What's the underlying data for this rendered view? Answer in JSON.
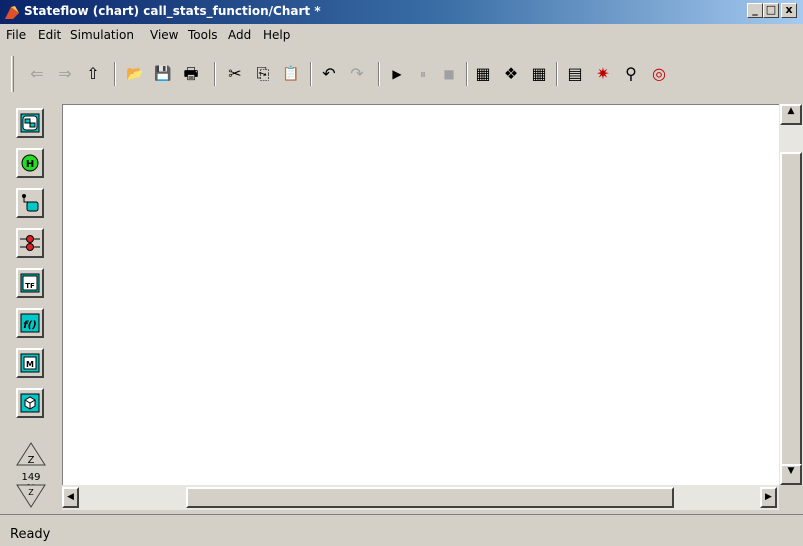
{
  "window": {
    "title": "Stateflow (chart) call_stats_function/Chart *",
    "controls": [
      {
        "name": "minimize-button",
        "glyph": "_"
      },
      {
        "name": "maximize-button",
        "glyph": "□"
      },
      {
        "name": "close-button",
        "glyph": "x"
      }
    ]
  },
  "menubar": {
    "items": [
      "File",
      "Edit",
      "Simulation",
      "View",
      "Tools",
      "Add",
      "Help"
    ]
  },
  "toolbar": {
    "buttons": [
      {
        "icon": "back-arrow-icon",
        "glyph": "⇐",
        "enabled": false
      },
      {
        "icon": "forward-arrow-icon",
        "glyph": "⇒",
        "enabled": false
      },
      {
        "icon": "up-arrow-icon",
        "glyph": "⇧",
        "enabled": true
      },
      {
        "icon": "open-folder-icon",
        "glyph": "📂",
        "enabled": true
      },
      {
        "icon": "save-icon",
        "glyph": "💾",
        "enabled": true
      },
      {
        "icon": "print-icon",
        "glyph": "🖶",
        "enabled": true
      },
      {
        "icon": "cut-icon",
        "glyph": "✂",
        "enabled": true
      },
      {
        "icon": "copy-icon",
        "glyph": "⎘",
        "enabled": true
      },
      {
        "icon": "paste-icon",
        "glyph": "📋",
        "enabled": true
      },
      {
        "icon": "undo-icon",
        "glyph": "↶",
        "enabled": true
      },
      {
        "icon": "redo-icon",
        "glyph": "↷",
        "enabled": false
      },
      {
        "icon": "start-simulation-icon",
        "glyph": "▶",
        "enabled": true
      },
      {
        "icon": "pause-simulation-icon",
        "glyph": "⏸",
        "enabled": false
      },
      {
        "icon": "stop-simulation-icon",
        "glyph": "■",
        "enabled": false
      },
      {
        "icon": "build-icon",
        "glyph": "▦",
        "enabled": true
      },
      {
        "icon": "incremental-build-icon",
        "glyph": "❖",
        "enabled": true
      },
      {
        "icon": "rebuild-all-icon",
        "glyph": "▦",
        "enabled": true
      },
      {
        "icon": "model-explorer-icon",
        "glyph": "▤",
        "enabled": true
      },
      {
        "icon": "debugger-icon",
        "glyph": "✷",
        "enabled": true
      },
      {
        "icon": "find-icon",
        "glyph": "⚲",
        "enabled": true
      },
      {
        "icon": "target-icon",
        "glyph": "◎",
        "enabled": true
      }
    ]
  },
  "palette": {
    "tools": [
      {
        "name": "state-tool",
        "icon": "state-icon"
      },
      {
        "name": "history-junction-tool",
        "icon": "history-junction-icon",
        "label": "H"
      },
      {
        "name": "default-transition-tool",
        "icon": "default-transition-icon"
      },
      {
        "name": "connective-junction-tool",
        "icon": "connective-junction-icon"
      },
      {
        "name": "truth-table-tool",
        "icon": "truth-table-icon",
        "label": "TF"
      },
      {
        "name": "graphical-function-tool",
        "icon": "graphical-function-icon",
        "label": "f()"
      },
      {
        "name": "embedded-matlab-tool",
        "icon": "embedded-matlab-icon",
        "label": "M"
      },
      {
        "name": "box-tool",
        "icon": "box-icon"
      }
    ],
    "zoom": {
      "label": "149 %",
      "in_letter": "Z",
      "out_letter": "Z"
    }
  },
  "status": {
    "text": "Ready"
  },
  "colors": {
    "title_start": "#0a246a",
    "title_end": "#a6caf0",
    "chrome": "#d4d0c8",
    "tool_icon": "#00c8c8",
    "canvas": "#ffffff"
  }
}
